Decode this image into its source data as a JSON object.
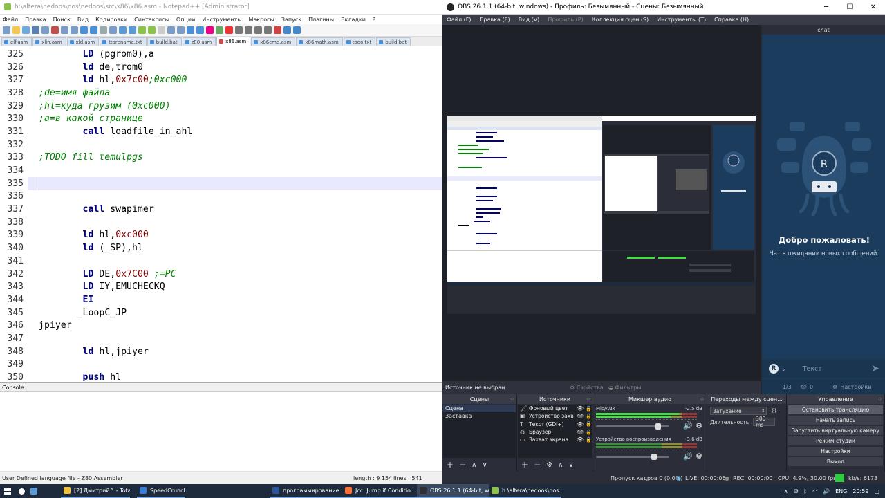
{
  "npp": {
    "title": "h:\\altera\\nedoos\\nos\\nedoos\\src\\x86\\x86.asm - Notepad++ [Administrator]",
    "menu": [
      "Файл",
      "Правка",
      "Поиск",
      "Вид",
      "Кодировки",
      "Синтаксисы",
      "Опции",
      "Инструменты",
      "Макросы",
      "Запуск",
      "Плагины",
      "Вкладки",
      "?"
    ],
    "tabs": [
      "elf.asm",
      "xlin.asm",
      "xld.asm",
      "ttarename.txt",
      "build.bat",
      "z80.asm",
      "x86.asm",
      "x86cmd.asm",
      "x86math.asm",
      "todo.txt",
      "build.bat"
    ],
    "active_tab": "x86.asm",
    "lines": [
      {
        "n": "325",
        "text": "        LD (pgrom0),a"
      },
      {
        "n": "326",
        "text": "        ld de,trom0"
      },
      {
        "n": "327",
        "text": "        ld hl,0x7c00;0xc000"
      },
      {
        "n": "328",
        "text": ";de=имя файла"
      },
      {
        "n": "329",
        "text": ";hl=куда грузим (0xc000)"
      },
      {
        "n": "330",
        "text": ";a=в какой странице"
      },
      {
        "n": "331",
        "text": "        call loadfile_in_ahl"
      },
      {
        "n": "332",
        "text": ""
      },
      {
        "n": "333",
        "text": ";TODO fill temulpgs"
      },
      {
        "n": "334",
        "text": ""
      },
      {
        "n": "335",
        "text": ""
      },
      {
        "n": "336",
        "text": ""
      },
      {
        "n": "337",
        "text": "        call swapimer"
      },
      {
        "n": "338",
        "text": ""
      },
      {
        "n": "339",
        "text": "        ld hl,0xc000"
      },
      {
        "n": "340",
        "text": "        ld (_SP),hl"
      },
      {
        "n": "341",
        "text": ""
      },
      {
        "n": "342",
        "text": "        LD DE,0x7C00 ;=PC"
      },
      {
        "n": "343",
        "text": "        LD IY,EMUCHECKQ"
      },
      {
        "n": "344",
        "text": "        EI"
      },
      {
        "n": "345",
        "text": "       _LoopC_JP"
      },
      {
        "n": "346",
        "text": "jpiyer"
      },
      {
        "n": "347",
        "text": ""
      },
      {
        "n": "348",
        "text": "        ld hl,jpiyer"
      },
      {
        "n": "349",
        "text": ""
      },
      {
        "n": "350",
        "text": "        push hl"
      }
    ],
    "console_label": "Console",
    "status_lang": "User Defined language file - Z80 Assembler",
    "status_length": "length : 9 154",
    "status_lines": "lines : 541"
  },
  "obs": {
    "title": "OBS 26.1.1 (64-bit, windows) - Профиль: Безымянный - Сцены: Безымянный",
    "menu": [
      {
        "label": "Файл (F)",
        "disabled": false
      },
      {
        "label": "Правка (E)",
        "disabled": false
      },
      {
        "label": "Вид (V)",
        "disabled": false
      },
      {
        "label": "Профиль (P)",
        "disabled": true
      },
      {
        "label": "Коллекция сцен (S)",
        "disabled": false
      },
      {
        "label": "Инструменты (T)",
        "disabled": false
      },
      {
        "label": "Справка (H)",
        "disabled": false
      }
    ],
    "no_source": "Источник не выбран",
    "properties": "Свойства",
    "filters": "Фильтры",
    "chat": {
      "header": "chat",
      "welcome": "Добро пожаловать!",
      "waiting": "Чат в ожидании новых сообщений.",
      "input_placeholder": "Текст",
      "page": "1/3",
      "viewers": "0",
      "settings": "Настройки"
    },
    "scenes": {
      "title": "Сцены",
      "items": [
        "Сцена",
        "Заставка"
      ]
    },
    "sources": {
      "title": "Источники",
      "items": [
        {
          "icon": "paint-icon",
          "glyph": "🖌",
          "name": "Фоновый цвет"
        },
        {
          "icon": "camera-icon",
          "glyph": "▣",
          "name": "Устройство захв"
        },
        {
          "icon": "text-icon",
          "glyph": "T",
          "name": "Текст (GDI+)"
        },
        {
          "icon": "globe-icon",
          "glyph": "◍",
          "name": "Браузер"
        },
        {
          "icon": "monitor-icon",
          "glyph": "▭",
          "name": "Захват экрана"
        }
      ]
    },
    "mixer": {
      "title": "Микшер аудио",
      "channels": [
        {
          "name": "Mic/Aux",
          "db": "-2.5 dB",
          "level": 0.82,
          "volume": 0.88
        },
        {
          "name": "Устройство воспроизведения",
          "db": "-3.6 dB",
          "level": 0.0,
          "volume": 0.82
        }
      ]
    },
    "transitions": {
      "title": "Переходы между сцен...",
      "type": "Затухание",
      "duration_label": "Длительность",
      "duration": "300 ms"
    },
    "controls": {
      "title": "Управление",
      "buttons": [
        "Остановить трансляцию",
        "Начать запись",
        "Запустить виртуальную камеру",
        "Режим студии",
        "Настройки",
        "Выход"
      ]
    },
    "status": {
      "dropped": "Пропуск кадров 0 (0.0%)",
      "live": "LIVE: 00:00:06",
      "rec": "REC: 00:00:00",
      "cpu": "CPU: 4.9%, 30.00 fps",
      "kbps": "kb/s: 6173"
    }
  },
  "taskbar": {
    "tasks": [
      {
        "label": "[2] Дмитрий^ - Total ...",
        "color": "#f0c040"
      },
      {
        "label": "SpeedCrunch",
        "color": "#3a7bd5"
      },
      {
        "label": "программирование ...",
        "color": "#2b579a"
      },
      {
        "label": "Jcc: Jump if Conditio...",
        "color": "#ff7139"
      },
      {
        "label": "OBS 26.1.1 (64-bit, wi...",
        "color": "#302e31"
      },
      {
        "label": "h:\\altera\\nedoos\\nos...",
        "color": "#8bc34a"
      }
    ],
    "lang": "ENG",
    "time": "20:59"
  }
}
